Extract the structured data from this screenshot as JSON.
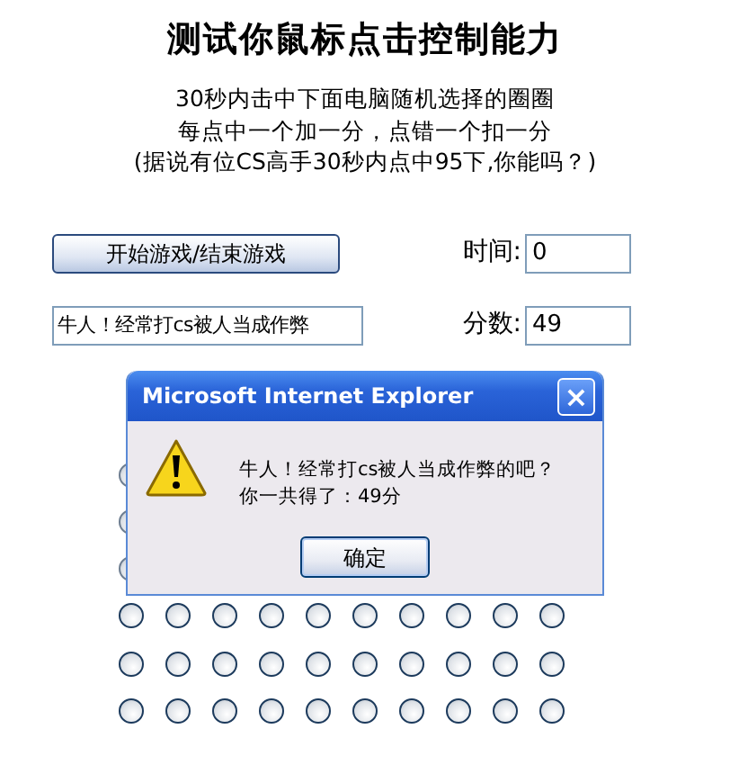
{
  "title": "测试你鼠标点击控制能力",
  "instructions": [
    "30秒内击中下面电脑随机选择的圈圈",
    "每点中一个加一分，点错一个扣一分",
    "(据说有位CS高手30秒内点中95下,你能吗？)"
  ],
  "start_button": "开始游戏/结束游戏",
  "time": {
    "label": "时间:",
    "value": "0"
  },
  "message_field": {
    "value": "牛人！经常打cs被人当成作弊"
  },
  "score": {
    "label": "分数:",
    "value": "49"
  },
  "circle_rows": [
    {
      "circles": [
        {
          "checked": false
        }
      ]
    },
    {
      "circles": [
        {
          "checked": false
        }
      ]
    },
    {
      "circles": [
        {
          "checked": false
        }
      ]
    },
    {
      "circles": [
        {
          "checked": false
        },
        {
          "checked": false
        },
        {
          "checked": false
        },
        {
          "checked": false
        },
        {
          "checked": false
        },
        {
          "checked": false
        },
        {
          "checked": false
        },
        {
          "checked": false
        },
        {
          "checked": false
        },
        {
          "checked": false
        }
      ]
    },
    {
      "circles": [
        {
          "checked": false
        },
        {
          "checked": false
        },
        {
          "checked": false
        },
        {
          "checked": false
        },
        {
          "checked": false
        },
        {
          "checked": false
        },
        {
          "checked": false
        },
        {
          "checked": false
        },
        {
          "checked": false
        },
        {
          "checked": false
        }
      ]
    },
    {
      "circles": [
        {
          "checked": false
        },
        {
          "checked": false
        },
        {
          "checked": false
        },
        {
          "checked": false
        },
        {
          "checked": false
        },
        {
          "checked": false
        },
        {
          "checked": false
        },
        {
          "checked": false
        },
        {
          "checked": false
        },
        {
          "checked": false
        }
      ]
    }
  ],
  "dialog": {
    "title": "Microsoft Internet Explorer",
    "close": "×",
    "message": [
      "牛人！经常打cs被人当成作弊的吧？",
      "你一共得了：49分"
    ],
    "button": "确定"
  }
}
